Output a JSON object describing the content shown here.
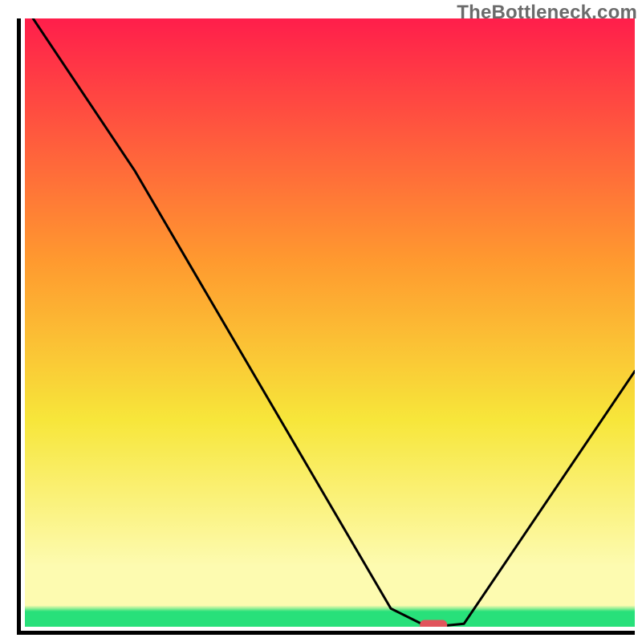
{
  "watermark": "TheBottleneck.com",
  "colors": {
    "red": "#FF1E4B",
    "orange": "#FF9A2F",
    "yellow_mid": "#F7E63A",
    "pale_yellow": "#FDFBB0",
    "green": "#28E07A",
    "curve": "#000000",
    "marker": "#E1545C",
    "axis": "#000000"
  },
  "chart_data": {
    "type": "line",
    "title": "",
    "xlabel": "",
    "ylabel": "",
    "xlim": [
      0,
      100
    ],
    "ylim": [
      0,
      100
    ],
    "x": [
      0,
      18,
      60,
      66,
      67,
      72,
      100
    ],
    "values": [
      102,
      75,
      3,
      0,
      0,
      0.5,
      42
    ],
    "marker_x": 67,
    "marker_y": 0,
    "notes": "No axis ticks, labels, or legend are visible in the image."
  }
}
